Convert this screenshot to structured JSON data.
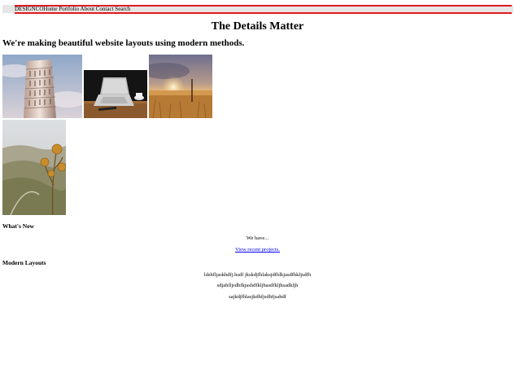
{
  "nav": {
    "items": [
      "DESIGNCO",
      "Home",
      "Portfolio",
      "About",
      "Contact",
      "Search"
    ],
    "accent": "#e0191f",
    "bar_bg": "#e6e6e6"
  },
  "header": {
    "title": "The Details Matter",
    "tagline": "We're making beautiful website layouts using modern methods."
  },
  "gallery": [
    {
      "icon": "leaning-tower-photo"
    },
    {
      "icon": "laptop-desk-photo"
    },
    {
      "icon": "field-sunset-photo"
    },
    {
      "icon": "thistle-valley-photo"
    }
  ],
  "whats_new": {
    "heading": "What's New",
    "text": "We have...",
    "link": "View recent projects."
  },
  "modern_layouts": {
    "heading": "Modern Layouts",
    "lines": [
      "ldshfljaskhdfj.hsdf jkskdjfhlaksjdfhlkjasdfhkljsdfh",
      "sdjahfljsdhfkjashdfkljhasdfkljhsadkljh",
      "sajkdjfhlasjkdhfjsdhfjsahdf"
    ]
  }
}
